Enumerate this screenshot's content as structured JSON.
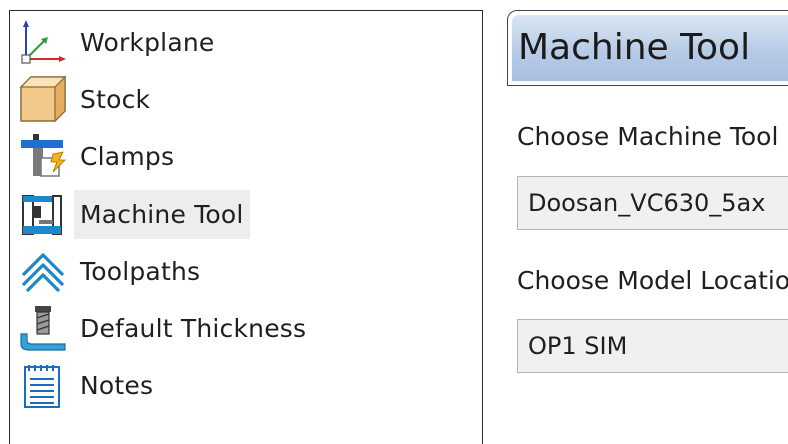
{
  "tree": {
    "items": [
      {
        "label": "Workplane",
        "icon": "workplane-axes-icon"
      },
      {
        "label": "Stock",
        "icon": "stock-box-icon"
      },
      {
        "label": "Clamps",
        "icon": "clamps-icon"
      },
      {
        "label": "Machine Tool",
        "icon": "machine-tool-icon",
        "selected": true
      },
      {
        "label": "Toolpaths",
        "icon": "toolpaths-icon"
      },
      {
        "label": "Default Thickness",
        "icon": "default-thickness-icon"
      },
      {
        "label": "Notes",
        "icon": "notes-icon"
      }
    ]
  },
  "panel": {
    "title": "Machine Tool",
    "machine_label": "Choose Machine Tool",
    "machine_value": "Doosan_VC630_5ax",
    "location_label": "Choose Model Location",
    "location_value": "OP1 SIM"
  },
  "colors": {
    "header_gradient_top": "#dbe6f5",
    "header_gradient_bottom": "#a7bfe0",
    "selected_bg": "#ededed",
    "field_bg": "#f0f0f0"
  }
}
